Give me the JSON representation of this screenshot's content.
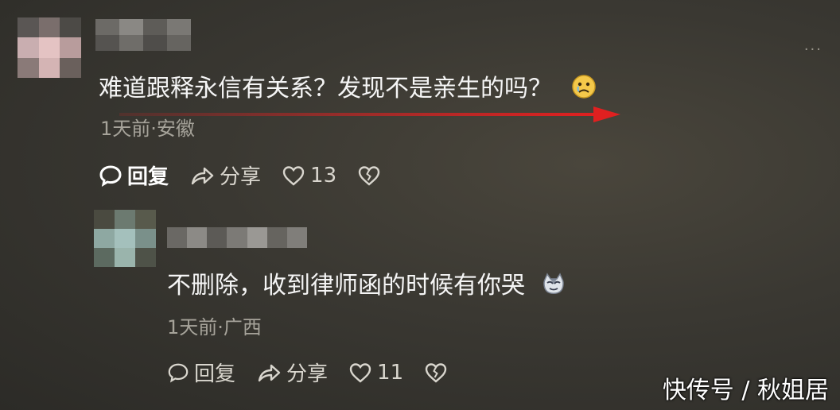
{
  "comments": [
    {
      "text": "难道跟释永信有关系？发现不是亲生的吗？",
      "emoji": "sad-face-emoji",
      "meta": "1天前·安徽",
      "reply_label": "回复",
      "share_label": "分享",
      "likes": "13"
    },
    {
      "text": "不删除，收到律师函的时候有你哭",
      "emoji": "cat-emoji",
      "meta": "1天前·广西",
      "reply_label": "回复",
      "share_label": "分享",
      "likes": "11"
    }
  ],
  "more_menu": "···",
  "watermark": "快传号 / 秋姐居",
  "colors": {
    "arrow": "#e02020",
    "background": "#3a3832",
    "meta_text": "#a6a39a"
  }
}
